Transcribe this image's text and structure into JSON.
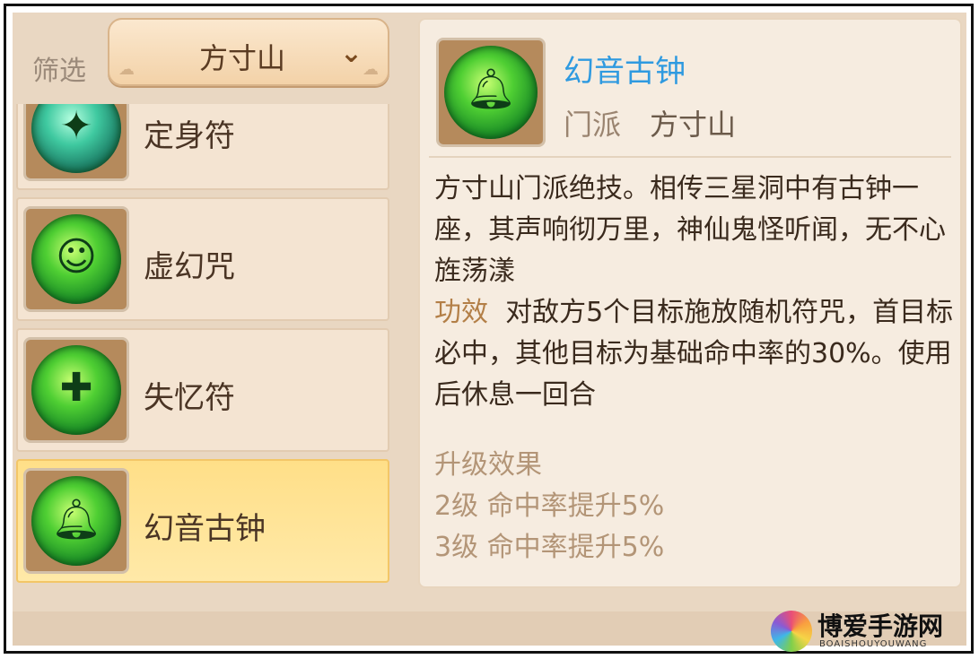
{
  "filter": {
    "label": "筛选",
    "selected": "方寸山",
    "chevron": "⌄"
  },
  "skills": [
    {
      "name": "定身符",
      "icon": "spirit-figure-icon"
    },
    {
      "name": "虚幻咒",
      "icon": "green-ghost-icon"
    },
    {
      "name": "失忆符",
      "icon": "confused-figure-icon"
    },
    {
      "name": "幻音古钟",
      "icon": "bell-icon",
      "selected": true
    }
  ],
  "detail": {
    "title": "幻音古钟",
    "sect_label": "门派",
    "sect_value": "方寸山",
    "description": "方寸山门派绝技。相传三星洞中有古钟一座，其声响彻万里，神仙鬼怪听闻，无不心旌荡漾",
    "effect_label": "功效",
    "effect_text": "对敌方5个目标施放随机符咒，首目标必中，其他目标为基础命中率的30%。使用后休息一回合",
    "upgrade_title": "升级效果",
    "upgrades": [
      "2级  命中率提升5%",
      "3级  命中率提升5%"
    ]
  },
  "watermark": {
    "name": "博爱手游网",
    "sub": "BOAISHOUYOUWANG"
  },
  "colors": {
    "title_blue": "#2f9ae0",
    "selected_bg": "#ffdf88",
    "panel_bg": "#f6ece0"
  }
}
